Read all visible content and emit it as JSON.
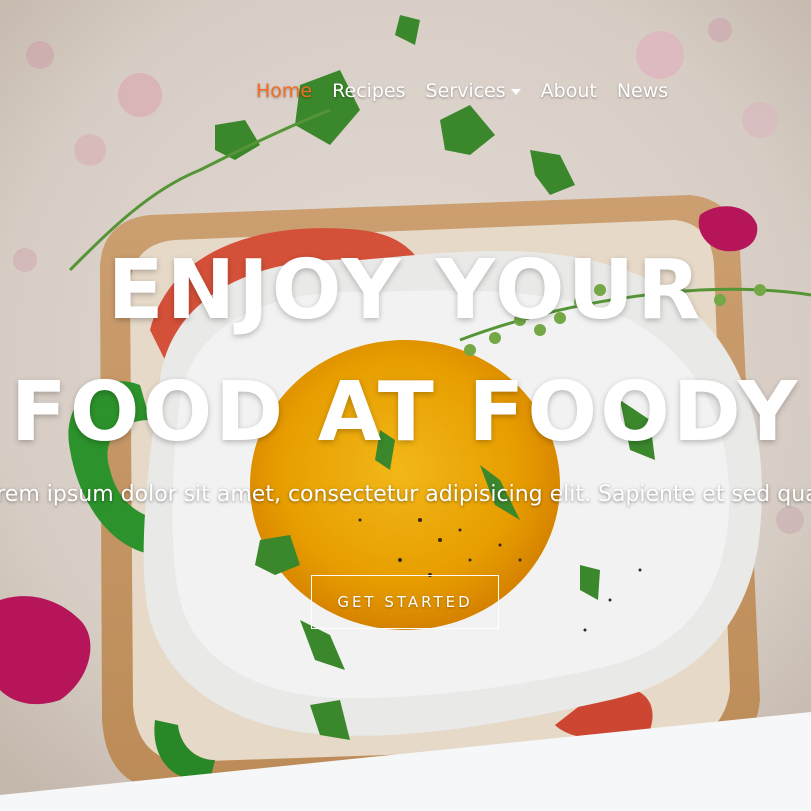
{
  "nav": {
    "items": [
      {
        "label": "Home",
        "active": true
      },
      {
        "label": "Recipes",
        "active": false
      },
      {
        "label": "Services",
        "active": false
      },
      {
        "label": "About",
        "active": false
      },
      {
        "label": "News",
        "active": false
      }
    ],
    "active_color": "#f36c21"
  },
  "hero": {
    "headline_line1": "ENJOY YOUR",
    "headline_line2": "FOOD AT FOODY",
    "subtitle": "Lorem ipsum dolor sit amet, consectetur adipisicing elit. Sapiente et sed quam",
    "cta_label": "GET STARTED"
  }
}
